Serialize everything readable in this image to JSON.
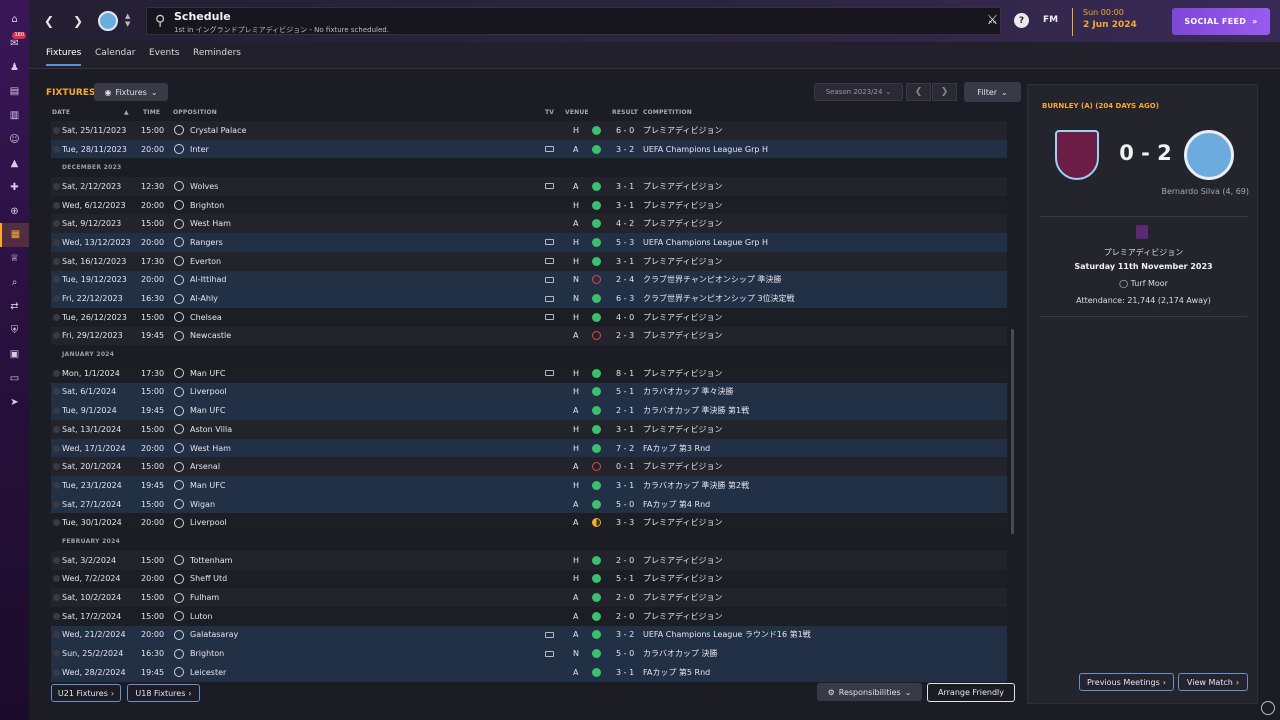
{
  "rail": {
    "icons": [
      "home-icon",
      "inbox-icon",
      "squad-icon",
      "tactics-icon",
      "data-icon",
      "staff-icon",
      "dynamics-icon",
      "training-icon",
      "medical-icon",
      "schedule-icon",
      "competitions-icon",
      "scouting-icon",
      "transfers-icon",
      "club-vision-icon",
      "finances-icon",
      "dev-centre-icon",
      "report-icon"
    ],
    "badge": "160"
  },
  "header": {
    "title": "Schedule",
    "subtitle": "1st in イングランドプレミアディビジョン - No fixture scheduled.",
    "fm_logo": "FM",
    "help": "?",
    "time": "Sun 00:00",
    "date": "2 Jun 2024",
    "social_feed": "SOCIAL FEED"
  },
  "subtabs": [
    "Fixtures",
    "Calendar",
    "Events",
    "Reminders"
  ],
  "main": {
    "title": "FIXTURES",
    "view_dropdown": "Fixtures",
    "season": "Season 2023/24",
    "filter": "Filter",
    "columns": {
      "date": "DATE",
      "time": "TIME",
      "opposition": "OPPOSITION",
      "tv": "TV",
      "venue": "VENUE",
      "result": "RESULT",
      "competition": "COMPETITION"
    },
    "rows": [
      {
        "kind": "match",
        "date": "Sat, 25/11/2023",
        "time": "15:00",
        "opp": "Crystal Palace",
        "tv": false,
        "venue": "H",
        "outcome": "w",
        "result": "6 - 0",
        "comp": "プレミアディビジョン",
        "hl": false
      },
      {
        "kind": "match",
        "date": "Tue, 28/11/2023",
        "time": "20:00",
        "opp": "Inter",
        "tv": true,
        "venue": "A",
        "outcome": "w",
        "result": "3 - 2",
        "comp": "UEFA Champions League Grp H",
        "hl": true
      },
      {
        "kind": "section",
        "label": "DECEMBER 2023"
      },
      {
        "kind": "match",
        "date": "Sat, 2/12/2023",
        "time": "12:30",
        "opp": "Wolves",
        "tv": true,
        "venue": "A",
        "outcome": "w",
        "result": "3 - 1",
        "comp": "プレミアディビジョン",
        "hl": false
      },
      {
        "kind": "match",
        "date": "Wed, 6/12/2023",
        "time": "20:00",
        "opp": "Brighton",
        "tv": false,
        "venue": "H",
        "outcome": "w",
        "result": "3 - 1",
        "comp": "プレミアディビジョン",
        "hl": false
      },
      {
        "kind": "match",
        "date": "Sat, 9/12/2023",
        "time": "15:00",
        "opp": "West Ham",
        "tv": false,
        "venue": "A",
        "outcome": "w",
        "result": "4 - 2",
        "comp": "プレミアディビジョン",
        "hl": false
      },
      {
        "kind": "match",
        "date": "Wed, 13/12/2023",
        "time": "20:00",
        "opp": "Rangers",
        "tv": true,
        "venue": "H",
        "outcome": "w",
        "result": "5 - 3",
        "comp": "UEFA Champions League Grp H",
        "hl": true
      },
      {
        "kind": "match",
        "date": "Sat, 16/12/2023",
        "time": "17:30",
        "opp": "Everton",
        "tv": true,
        "venue": "H",
        "outcome": "w",
        "result": "3 - 1",
        "comp": "プレミアディビジョン",
        "hl": false
      },
      {
        "kind": "match",
        "date": "Tue, 19/12/2023",
        "time": "20:00",
        "opp": "Al-Ittihad",
        "tv": true,
        "venue": "N",
        "outcome": "l",
        "result": "2 - 4",
        "comp": "クラブ世界チャンピオンシップ 準決勝",
        "hl": true
      },
      {
        "kind": "match",
        "date": "Fri, 22/12/2023",
        "time": "16:30",
        "opp": "Al-Ahly",
        "tv": true,
        "venue": "N",
        "outcome": "w",
        "result": "6 - 3",
        "comp": "クラブ世界チャンピオンシップ 3位決定戦",
        "hl": true
      },
      {
        "kind": "match",
        "date": "Tue, 26/12/2023",
        "time": "15:00",
        "opp": "Chelsea",
        "tv": true,
        "venue": "H",
        "outcome": "w",
        "result": "4 - 0",
        "comp": "プレミアディビジョン",
        "hl": false
      },
      {
        "kind": "match",
        "date": "Fri, 29/12/2023",
        "time": "19:45",
        "opp": "Newcastle",
        "tv": false,
        "venue": "A",
        "outcome": "l",
        "result": "2 - 3",
        "comp": "プレミアディビジョン",
        "hl": false
      },
      {
        "kind": "section",
        "label": "JANUARY 2024"
      },
      {
        "kind": "match",
        "date": "Mon, 1/1/2024",
        "time": "17:30",
        "opp": "Man UFC",
        "tv": true,
        "venue": "H",
        "outcome": "w",
        "result": "8 - 1",
        "comp": "プレミアディビジョン",
        "hl": false
      },
      {
        "kind": "match",
        "date": "Sat, 6/1/2024",
        "time": "15:00",
        "opp": "Liverpool",
        "tv": false,
        "venue": "H",
        "outcome": "w",
        "result": "5 - 1",
        "comp": "カラバオカップ 準々決勝",
        "hl": true
      },
      {
        "kind": "match",
        "date": "Tue, 9/1/2024",
        "time": "19:45",
        "opp": "Man UFC",
        "tv": false,
        "venue": "A",
        "outcome": "w",
        "result": "2 - 1",
        "comp": "カラバオカップ 準決勝 第1戦",
        "hl": true
      },
      {
        "kind": "match",
        "date": "Sat, 13/1/2024",
        "time": "15:00",
        "opp": "Aston Villa",
        "tv": false,
        "venue": "H",
        "outcome": "w",
        "result": "3 - 1",
        "comp": "プレミアディビジョン",
        "hl": false
      },
      {
        "kind": "match",
        "date": "Wed, 17/1/2024",
        "time": "20:00",
        "opp": "West Ham",
        "tv": false,
        "venue": "H",
        "outcome": "w",
        "result": "7 - 2",
        "comp": "FAカップ 第3 Rnd",
        "hl": true
      },
      {
        "kind": "match",
        "date": "Sat, 20/1/2024",
        "time": "15:00",
        "opp": "Arsenal",
        "tv": false,
        "venue": "A",
        "outcome": "l",
        "result": "0 - 1",
        "comp": "プレミアディビジョン",
        "hl": false
      },
      {
        "kind": "match",
        "date": "Tue, 23/1/2024",
        "time": "19:45",
        "opp": "Man UFC",
        "tv": false,
        "venue": "H",
        "outcome": "w",
        "result": "3 - 1",
        "comp": "カラバオカップ 準決勝 第2戦",
        "hl": true
      },
      {
        "kind": "match",
        "date": "Sat, 27/1/2024",
        "time": "15:00",
        "opp": "Wigan",
        "tv": false,
        "venue": "A",
        "outcome": "w",
        "result": "5 - 0",
        "comp": "FAカップ 第4 Rnd",
        "hl": true
      },
      {
        "kind": "match",
        "date": "Tue, 30/1/2024",
        "time": "20:00",
        "opp": "Liverpool",
        "tv": false,
        "venue": "A",
        "outcome": "d",
        "result": "3 - 3",
        "comp": "プレミアディビジョン",
        "hl": false
      },
      {
        "kind": "section",
        "label": "FEBRUARY 2024"
      },
      {
        "kind": "match",
        "date": "Sat, 3/2/2024",
        "time": "15:00",
        "opp": "Tottenham",
        "tv": false,
        "venue": "H",
        "outcome": "w",
        "result": "2 - 0",
        "comp": "プレミアディビジョン",
        "hl": false
      },
      {
        "kind": "match",
        "date": "Wed, 7/2/2024",
        "time": "20:00",
        "opp": "Sheff Utd",
        "tv": false,
        "venue": "H",
        "outcome": "w",
        "result": "5 - 1",
        "comp": "プレミアディビジョン",
        "hl": false
      },
      {
        "kind": "match",
        "date": "Sat, 10/2/2024",
        "time": "15:00",
        "opp": "Fulham",
        "tv": false,
        "venue": "A",
        "outcome": "w",
        "result": "2 - 0",
        "comp": "プレミアディビジョン",
        "hl": false
      },
      {
        "kind": "match",
        "date": "Sat, 17/2/2024",
        "time": "15:00",
        "opp": "Luton",
        "tv": false,
        "venue": "A",
        "outcome": "w",
        "result": "2 - 0",
        "comp": "プレミアディビジョン",
        "hl": false
      },
      {
        "kind": "match",
        "date": "Wed, 21/2/2024",
        "time": "20:00",
        "opp": "Galatasaray",
        "tv": true,
        "venue": "A",
        "outcome": "w",
        "result": "3 - 2",
        "comp": "UEFA Champions League ラウンド16 第1戦",
        "hl": true
      },
      {
        "kind": "match",
        "date": "Sun, 25/2/2024",
        "time": "16:30",
        "opp": "Brighton",
        "tv": true,
        "venue": "N",
        "outcome": "w",
        "result": "5 - 0",
        "comp": "カラバオカップ 決勝",
        "hl": true
      },
      {
        "kind": "match",
        "date": "Wed, 28/2/2024",
        "time": "19:45",
        "opp": "Leicester",
        "tv": false,
        "venue": "A",
        "outcome": "w",
        "result": "3 - 1",
        "comp": "FAカップ 第5 Rnd",
        "hl": true
      }
    ],
    "u21": "U21 Fixtures",
    "u18": "U18 Fixtures",
    "responsibilities": "Responsibilities",
    "arrange_friendly": "Arrange Friendly"
  },
  "side": {
    "title": "BURNLEY (A) (204 DAYS AGO)",
    "score": "0 - 2",
    "scorer": "Bernardo Silva (4, 69)",
    "competition": "プレミアディビジョン",
    "match_date": "Saturday 11th November 2023",
    "stadium": "Turf Moor",
    "attendance": "Attendance: 21,744 (2,174 Away)",
    "previous_meetings": "Previous Meetings",
    "view_match": "View Match"
  },
  "colors": {
    "accent": "#f7a832",
    "win": "#3cbf6f",
    "loss": "#e0454d",
    "draw": "#f0b132",
    "highlight_row": "#223046"
  }
}
